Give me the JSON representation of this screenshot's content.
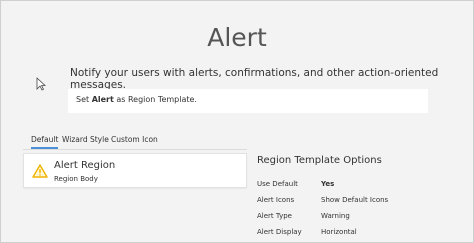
{
  "page": {
    "title": "Alert",
    "description": "Notify your users with alerts, confirmations, and other action-oriented messages.",
    "template_note": {
      "prefix": "Set ",
      "bold": "Alert",
      "suffix": " as Region Template."
    }
  },
  "tabs": [
    {
      "label": "Default",
      "active": true
    },
    {
      "label": "Wizard Style",
      "active": false
    },
    {
      "label": "Custom Icon",
      "active": false
    }
  ],
  "alert": {
    "title": "Alert Region",
    "body": "Region Body",
    "icon": "warning-icon",
    "icon_color": "#f0b400"
  },
  "options": {
    "title": "Region Template Options",
    "rows": [
      {
        "label": "Use Default",
        "value": "Yes"
      },
      {
        "label": "Alert Icons",
        "value": "Show Default Icons"
      },
      {
        "label": "Alert Type",
        "value": "Warning"
      },
      {
        "label": "Alert Display",
        "value": "Horizontal"
      }
    ]
  },
  "colors": {
    "accent": "#4a90d9",
    "background": "#f3f3f3"
  }
}
